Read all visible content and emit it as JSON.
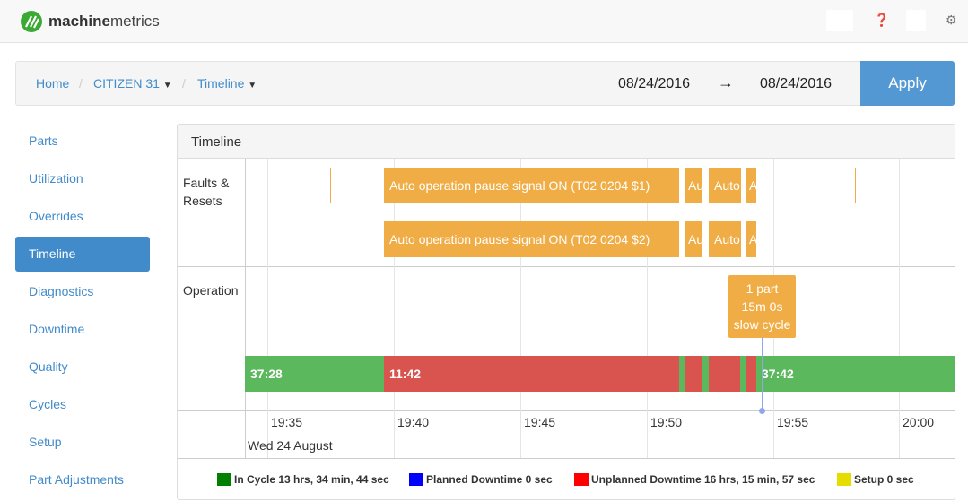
{
  "app": {
    "brand_bold": "machine",
    "brand_light": "metrics",
    "brand_color": "#3aaa35",
    "icons": [
      "help-icon",
      "gear-icon"
    ]
  },
  "breadcrumb": {
    "home": "Home",
    "machine": "CITIZEN 31",
    "page": "Timeline"
  },
  "dates": {
    "from": "08/24/2016",
    "arrow": "→",
    "to": "08/24/2016",
    "apply": "Apply"
  },
  "sidebar": {
    "items": [
      {
        "label": "Parts"
      },
      {
        "label": "Utilization"
      },
      {
        "label": "Overrides"
      },
      {
        "label": "Timeline",
        "active": true
      },
      {
        "label": "Diagnostics"
      },
      {
        "label": "Downtime"
      },
      {
        "label": "Quality"
      },
      {
        "label": "Cycles"
      },
      {
        "label": "Setup"
      },
      {
        "label": "Part Adjustments"
      }
    ]
  },
  "panel": {
    "title": "Timeline",
    "faults_label": "Faults & Resets",
    "operation_label": "Operation",
    "date_label": "Wed 24 August"
  },
  "faults": {
    "row1": [
      "Auto operation pause signal ON (T02 0204 $1)",
      "Au",
      "Auto",
      "A"
    ],
    "row2": [
      "Auto operation pause signal ON (T02 0204 $2)",
      "Au",
      "Auto",
      "A"
    ]
  },
  "operation": {
    "segments": [
      {
        "state": "in-cycle",
        "label": "37:28"
      },
      {
        "state": "unplanned",
        "label": "11:42"
      },
      {
        "state": "in-cycle",
        "label": ""
      },
      {
        "state": "unplanned",
        "label": ""
      },
      {
        "state": "in-cycle",
        "label": ""
      },
      {
        "state": "unplanned",
        "label": ""
      },
      {
        "state": "in-cycle",
        "label": ""
      },
      {
        "state": "unplanned",
        "label": ""
      },
      {
        "state": "in-cycle",
        "label": "37:42"
      }
    ],
    "tooltip": {
      "line1": "1 part",
      "line2": "15m 0s",
      "line3": "slow cycle"
    }
  },
  "axis": {
    "ticks": [
      "19:35",
      "19:40",
      "19:45",
      "19:50",
      "19:55",
      "20:00"
    ]
  },
  "legend": [
    {
      "label": "In Cycle 13 hrs, 34 min, 44 sec",
      "color": "#008000"
    },
    {
      "label": "Planned Downtime 0 sec",
      "color": "#0000ff"
    },
    {
      "label": "Unplanned Downtime 16 hrs, 15 min, 57 sec",
      "color": "#ff0000"
    },
    {
      "label": "Setup 0 sec",
      "color": "#e5dc00"
    }
  ],
  "colors": {
    "in_cycle": "#5cb85c",
    "unplanned": "#d9534f",
    "fault": "#f0ad45",
    "accent": "#428bca"
  }
}
